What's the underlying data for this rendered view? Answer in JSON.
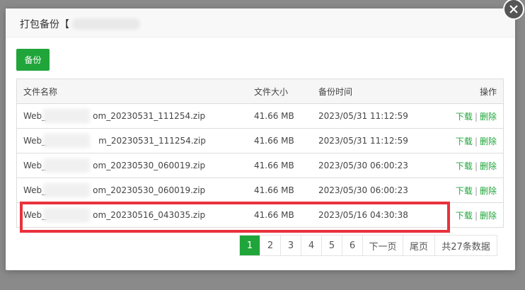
{
  "dialog": {
    "title_prefix": "打包备份【"
  },
  "toolbar": {
    "backup_label": "备份"
  },
  "table": {
    "headers": {
      "name": "文件名称",
      "size": "文件大小",
      "time": "备份时间",
      "actions": "操作"
    },
    "rows": [
      {
        "name_prefix": "Web_",
        "name_suffix": "om_20230531_111254.zip",
        "size": "41.66 MB",
        "time": "2023/05/31 11:12:59"
      },
      {
        "name_prefix": "Web_",
        "name_suffix": "m_20230531_111254.zip",
        "size": "41.66 MB",
        "time": "2023/05/31 11:12:59"
      },
      {
        "name_prefix": "Web_",
        "name_suffix": "om_20230530_060019.zip",
        "size": "41.66 MB",
        "time": "2023/05/30 06:00:23"
      },
      {
        "name_prefix": "Web_",
        "name_suffix": "om_20230530_060019.zip",
        "size": "41.66 MB",
        "time": "2023/05/30 06:00:23"
      },
      {
        "name_prefix": "Web_",
        "name_suffix": "om_20230516_043035.zip",
        "size": "41.66 MB",
        "time": "2023/05/16 04:30:38"
      }
    ],
    "download_label": "下载",
    "separator": "|",
    "delete_label": "删除"
  },
  "pagination": {
    "pages": [
      "1",
      "2",
      "3",
      "4",
      "5",
      "6"
    ],
    "next_label": "下一页",
    "last_label": "尾页",
    "total_label": "共27条数据"
  }
}
